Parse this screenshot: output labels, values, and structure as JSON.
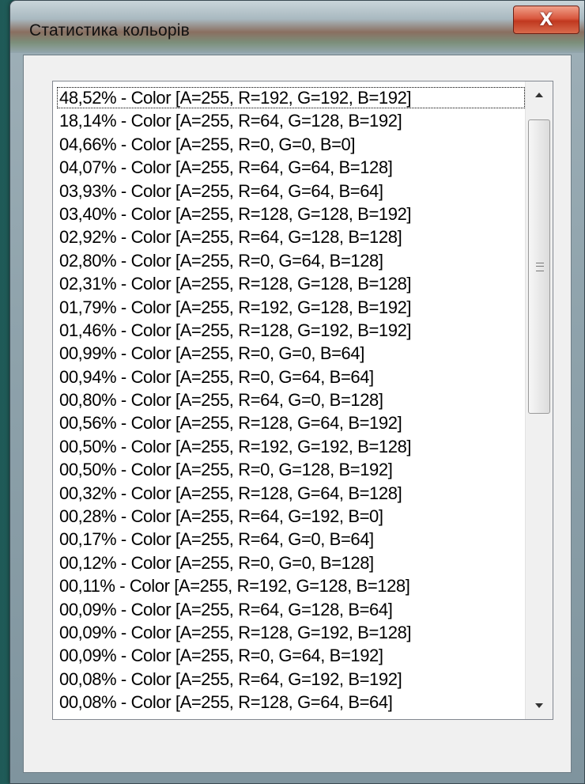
{
  "window": {
    "title": "Статистика кольорів",
    "close_label": "X"
  },
  "list": {
    "items": [
      "48,52%  - Color [A=255, R=192, G=192, B=192]",
      "18,14%  - Color [A=255, R=64, G=128, B=192]",
      "04,66%  - Color [A=255, R=0, G=0, B=0]",
      "04,07%  - Color [A=255, R=64, G=64, B=128]",
      "03,93%  - Color [A=255, R=64, G=64, B=64]",
      "03,40%  - Color [A=255, R=128, G=128, B=192]",
      "02,92%  - Color [A=255, R=64, G=128, B=128]",
      "02,80%  - Color [A=255, R=0, G=64, B=128]",
      "02,31%  - Color [A=255, R=128, G=128, B=128]",
      "01,79%  - Color [A=255, R=192, G=128, B=192]",
      "01,46%  - Color [A=255, R=128, G=192, B=192]",
      "00,99%  - Color [A=255, R=0, G=0, B=64]",
      "00,94%  - Color [A=255, R=0, G=64, B=64]",
      "00,80%  - Color [A=255, R=64, G=0, B=128]",
      "00,56%  - Color [A=255, R=128, G=64, B=192]",
      "00,50%  - Color [A=255, R=192, G=192, B=128]",
      "00,50%  - Color [A=255, R=0, G=128, B=192]",
      "00,32%  - Color [A=255, R=128, G=64, B=128]",
      "00,28%  - Color [A=255, R=64, G=192, B=0]",
      "00,17%  - Color [A=255, R=64, G=0, B=64]",
      "00,12%  - Color [A=255, R=0, G=0, B=128]",
      "00,11%  - Color [A=255, R=192, G=128, B=128]",
      "00,09%  - Color [A=255, R=64, G=128, B=64]",
      "00,09%  - Color [A=255, R=128, G=192, B=128]",
      "00,09%  - Color [A=255, R=0, G=64, B=192]",
      "00,08%  - Color [A=255, R=64, G=192, B=192]",
      "00,08%  - Color [A=255, R=128, G=64, B=64]"
    ],
    "focused_index": 0
  },
  "icons": {
    "close": "close-icon",
    "scroll_up": "chevron-up-icon",
    "scroll_down": "chevron-down-icon",
    "grip": "scroll-grip-icon"
  },
  "colors": {
    "close_button": "#c0381f",
    "list_background": "#ffffff",
    "desktop": "#2b6e69"
  }
}
